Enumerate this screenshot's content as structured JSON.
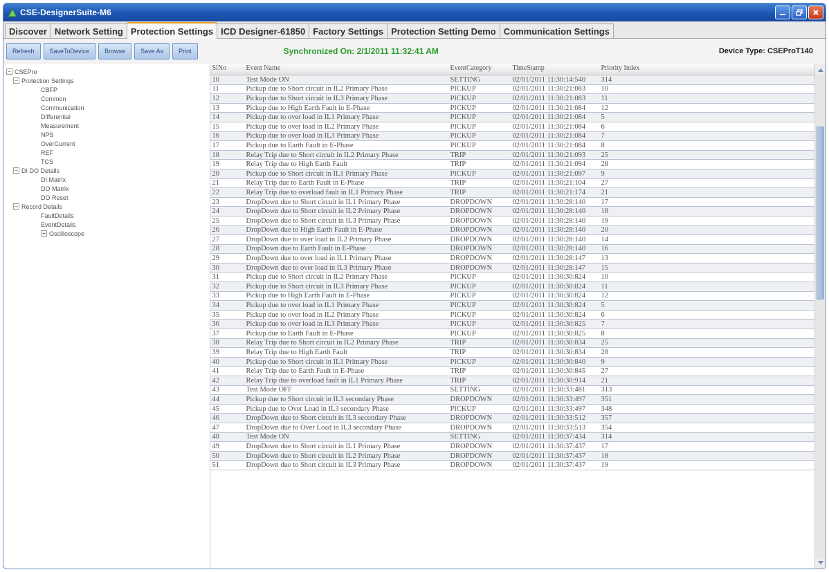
{
  "window": {
    "title": "CSE-DesignerSuite-M6"
  },
  "tabs": [
    {
      "label": "Discover"
    },
    {
      "label": "Network Setting"
    },
    {
      "label": "Protection Settings"
    },
    {
      "label": "ICD Designer-61850"
    },
    {
      "label": "Factory Settings"
    },
    {
      "label": "Protection Setting Demo"
    },
    {
      "label": "Communication Settings"
    }
  ],
  "toolbar": {
    "refresh": "Refresh",
    "save_to_device": "SaveToDevice",
    "browse": "Browse",
    "save_as": "Save As",
    "print": "Print",
    "sync": "Synchronized On: 2/1/2011 11:32:41 AM",
    "device_type": "Device Type: CSEProT140"
  },
  "tree": [
    {
      "label": "CSEPro",
      "level": 0,
      "exp": "−"
    },
    {
      "label": "Protection Settings",
      "level": 1,
      "exp": "−"
    },
    {
      "label": "CBFP",
      "level": 2
    },
    {
      "label": "Common",
      "level": 2
    },
    {
      "label": "Communication",
      "level": 2
    },
    {
      "label": "Differential",
      "level": 2
    },
    {
      "label": "Measurement",
      "level": 2
    },
    {
      "label": "NPS",
      "level": 2
    },
    {
      "label": "OverCurrent",
      "level": 2
    },
    {
      "label": "REF",
      "level": 2
    },
    {
      "label": "TCS",
      "level": 2
    },
    {
      "label": "DI DO Details",
      "level": 1,
      "exp": "−"
    },
    {
      "label": "DI Matrix",
      "level": 2
    },
    {
      "label": "DO Matrix",
      "level": 2
    },
    {
      "label": "DO Reset",
      "level": 2
    },
    {
      "label": "Record Details",
      "level": 1,
      "exp": "−"
    },
    {
      "label": "FaultDetails",
      "level": 2
    },
    {
      "label": "EventDetails",
      "level": 2
    },
    {
      "label": "Oscilloscope",
      "level": 2,
      "exp": "+"
    }
  ],
  "table": {
    "columns": [
      "SlNo",
      "Event Name",
      "EventCategory",
      "TimeStamp",
      "Priority Index"
    ],
    "rows": [
      [
        "10",
        " Test Mode ON",
        "SETTING",
        "02/01/2011 11:30:14:540",
        "314"
      ],
      [
        "11",
        "Pickup due to Short circuit in IL2 Primary Phase",
        "PICKUP",
        "02/01/2011 11:30:21:083",
        "10"
      ],
      [
        "12",
        "Pickup due to Short circuit in IL3 Primary Phase",
        "PICKUP",
        "02/01/2011 11:30:21:083",
        "11"
      ],
      [
        "13",
        "Pickup due to High Earth Fault in E-Phase",
        "PICKUP",
        "02/01/2011 11:30:21:084",
        "12"
      ],
      [
        "14",
        "Pickup due to over load in IL1 Primary Phase",
        "PICKUP",
        "02/01/2011 11:30:21:084",
        "5"
      ],
      [
        "15",
        "Pickup due to over load in IL2 Primary Phase",
        "PICKUP",
        "02/01/2011 11:30:21:084",
        "6"
      ],
      [
        "16",
        "Pickup due to over load in IL3 Primary Phase",
        "PICKUP",
        "02/01/2011 11:30:21:084",
        "7"
      ],
      [
        "17",
        "Pickup due to Earth Fault in E-Phase",
        "PICKUP",
        "02/01/2011 11:30:21:084",
        "8"
      ],
      [
        "18",
        "Relay Trip due to Short circuit in IL2 Primary Phase",
        "TRIP",
        "02/01/2011 11:30:21:093",
        "25"
      ],
      [
        "19",
        "Relay Trip due to High Earth Fault",
        "TRIP",
        "02/01/2011 11:30:21:094",
        "28"
      ],
      [
        "20",
        "Pickup due to Short circuit in IL1 Primary Phase",
        "PICKUP",
        "02/01/2011 11:30:21:097",
        "9"
      ],
      [
        "21",
        "Relay Trip due to Earth Fault in E-Phase",
        "TRIP",
        "02/01/2011 11:30:21:104",
        "27"
      ],
      [
        "22",
        "Relay Trip due to overload fault in IL1 Primary Phase",
        "TRIP",
        "02/01/2011 11:30:21:174",
        "21"
      ],
      [
        "23",
        "DropDown due to Short circuit in IL1 Primary Phase",
        "DROPDOWN",
        "02/01/2011 11:30:28:140",
        "17"
      ],
      [
        "24",
        "DropDown due to Short circuit in IL2 Primary Phase",
        "DROPDOWN",
        "02/01/2011 11:30:28:140",
        "18"
      ],
      [
        "25",
        "DropDown due to Short circuit in IL3 Primary Phase",
        "DROPDOWN",
        "02/01/2011 11:30:28:140",
        "19"
      ],
      [
        "26",
        "DropDown due to High Earth Fault in E-Phase",
        "DROPDOWN",
        "02/01/2011 11:30:28:140",
        "20"
      ],
      [
        "27",
        "DropDown due to over load in IL2 Primary Phase",
        "DROPDOWN",
        "02/01/2011 11:30:28:140",
        "14"
      ],
      [
        "28",
        "DropDown due to Earth Fault in E-Phase",
        "DROPDOWN",
        "02/01/2011 11:30:28:140",
        "16"
      ],
      [
        "29",
        "DropDown due to over load in IL1 Primary Phase",
        "DROPDOWN",
        "02/01/2011 11:30:28:147",
        "13"
      ],
      [
        "30",
        "DropDown due to over load in IL3 Primary Phase",
        "DROPDOWN",
        "02/01/2011 11:30:28:147",
        "15"
      ],
      [
        "31",
        "Pickup due to Short circuit in IL2 Primary Phase",
        "PICKUP",
        "02/01/2011 11:30:30:824",
        "10"
      ],
      [
        "32",
        "Pickup due to Short circuit in IL3 Primary Phase",
        "PICKUP",
        "02/01/2011 11:30:30:824",
        "11"
      ],
      [
        "33",
        "Pickup due to High Earth Fault in E-Phase",
        "PICKUP",
        "02/01/2011 11:30:30:824",
        "12"
      ],
      [
        "34",
        "Pickup due to over load in IL1 Primary Phase",
        "PICKUP",
        "02/01/2011 11:30:30:824",
        "5"
      ],
      [
        "35",
        "Pickup due to over load in IL2 Primary Phase",
        "PICKUP",
        "02/01/2011 11:30:30:824",
        "6"
      ],
      [
        "36",
        "Pickup due to over load in IL3 Primary Phase",
        "PICKUP",
        "02/01/2011 11:30:30:825",
        "7"
      ],
      [
        "37",
        "Pickup due to Earth Fault in E-Phase",
        "PICKUP",
        "02/01/2011 11:30:30:825",
        "8"
      ],
      [
        "38",
        "Relay Trip due to Short circuit in IL2 Primary Phase",
        "TRIP",
        "02/01/2011 11:30:30:834",
        "25"
      ],
      [
        "39",
        "Relay Trip due to High Earth Fault",
        "TRIP",
        "02/01/2011 11:30:30:834",
        "28"
      ],
      [
        "40",
        "Pickup due to Short circuit in IL1 Primary Phase",
        "PICKUP",
        "02/01/2011 11:30:30:840",
        "9"
      ],
      [
        "41",
        "Relay Trip due to Earth Fault in E-Phase",
        "TRIP",
        "02/01/2011 11:30:30:845",
        "27"
      ],
      [
        "42",
        "Relay Trip due to overload fault in IL1 Primary Phase",
        "TRIP",
        "02/01/2011 11:30:30:914",
        "21"
      ],
      [
        "43",
        " Test Mode OFF",
        "SETTING",
        "02/01/2011 11:30:33:481",
        "313"
      ],
      [
        "44",
        "Pickup due to Short circuit in IL3 secondary Phase",
        "DROPDOWN",
        "02/01/2011 11:30:33:497",
        "351"
      ],
      [
        "45",
        "Pickup due to Over Load in IL3 secondary Phase",
        "PICKUP",
        "02/01/2011 11:30:33:497",
        "348"
      ],
      [
        "46",
        "DropDown due to Short circuit in IL3 secondary Phase",
        "DROPDOWN",
        "02/01/2011 11:30:33:512",
        "357"
      ],
      [
        "47",
        "DropDown due to Over Load in IL3 secondary Phase",
        "DROPDOWN",
        "02/01/2011 11:30:33:513",
        "354"
      ],
      [
        "48",
        " Test Mode ON",
        "SETTING",
        "02/01/2011 11:30:37:434",
        "314"
      ],
      [
        "49",
        "DropDown due to Short circuit in IL1 Primary Phase",
        "DROPDOWN",
        "02/01/2011 11:30:37:437",
        "17"
      ],
      [
        "50",
        "DropDown due to Short circuit in IL2 Primary Phase",
        "DROPDOWN",
        "02/01/2011 11:30:37:437",
        "18"
      ],
      [
        "51",
        "DropDown due to Short circuit in IL3 Primary Phase",
        "DROPDOWN",
        "02/01/2011 11:30:37:437",
        "19"
      ]
    ]
  },
  "colors": {
    "title_bar": "#1c56b3",
    "sync_text": "#2a9a2a",
    "active_tab_accent": "#f0a030"
  }
}
